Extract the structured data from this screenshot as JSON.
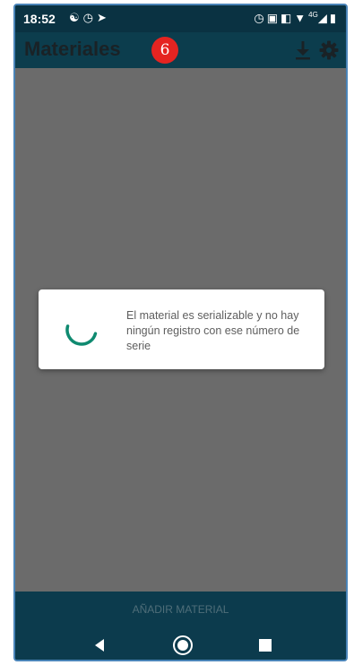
{
  "status_bar": {
    "time": "18:52",
    "left_icons": [
      "people-icon",
      "alarm-icon",
      "send-icon"
    ],
    "right_icons": [
      "alarm-icon",
      "nfc-icon",
      "vibrate-icon",
      "wifi-icon",
      "signal-icon",
      "battery-icon"
    ],
    "network_label": "4G"
  },
  "app_bar": {
    "title": "Materiales",
    "badge": "6",
    "badge_color": "#e52421",
    "actions": [
      "download-icon",
      "gear-icon"
    ]
  },
  "dialog": {
    "message": "El material es serializable y no hay ningún registro con ese número de serie",
    "spinner_color": "#0f8a70"
  },
  "bottom_bar": {
    "button_label": "AÑADIR MATERIAL"
  },
  "nav_bar": {
    "items": [
      "back-icon",
      "home-icon",
      "recents-icon"
    ]
  },
  "colors": {
    "primary_dark": "#0c3b4d",
    "overlay": "#6b6b6b",
    "frame": "#4a84b8"
  }
}
